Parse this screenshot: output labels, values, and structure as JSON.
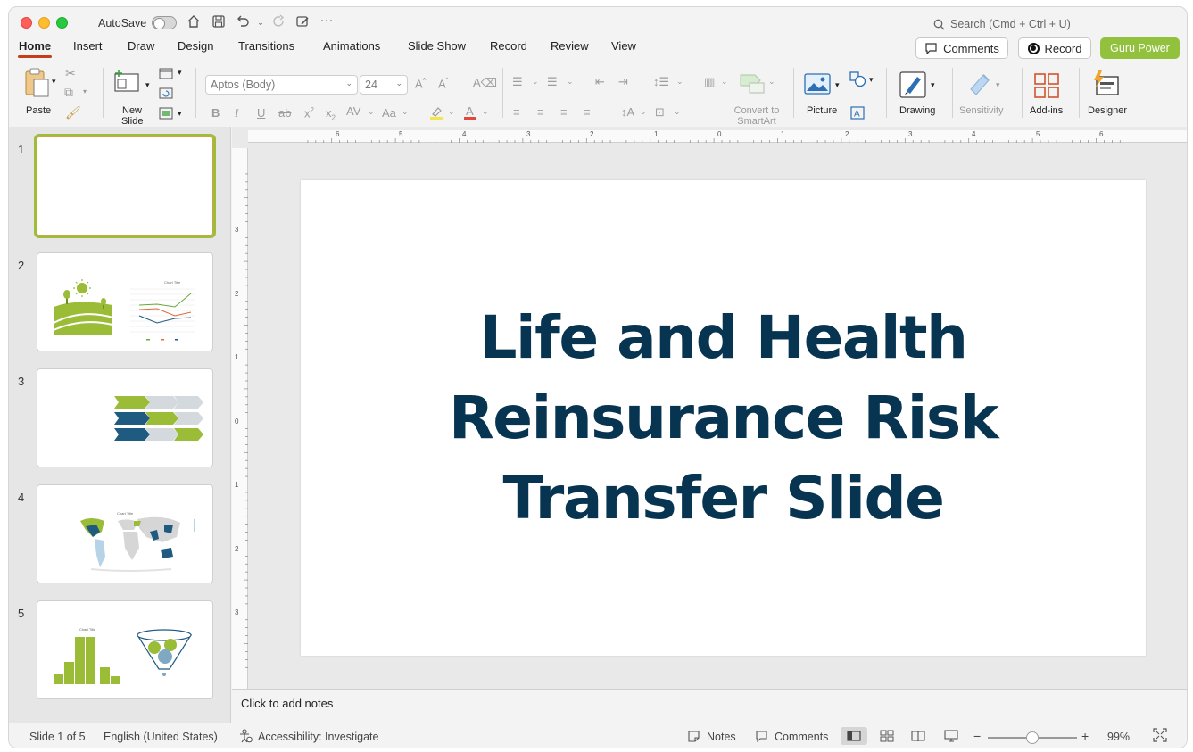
{
  "window": {
    "autosave_label": "AutoSave",
    "search_placeholder": "Search (Cmd + Ctrl + U)"
  },
  "tabs": [
    "Home",
    "Insert",
    "Draw",
    "Design",
    "Transitions",
    "Animations",
    "Slide Show",
    "Record",
    "Review",
    "View"
  ],
  "header_buttons": {
    "comments": "Comments",
    "record": "Record",
    "guru": "Guru Power"
  },
  "ribbon": {
    "paste": "Paste",
    "new_slide_1": "New",
    "new_slide_2": "Slide",
    "font_name": "Aptos (Body)",
    "font_size": "24",
    "convert_smartart_1": "Convert to",
    "convert_smartart_2": "SmartArt",
    "picture": "Picture",
    "drawing": "Drawing",
    "sensitivity": "Sensitivity",
    "addins": "Add-ins",
    "designer": "Designer"
  },
  "ruler": {
    "h_ticks": [
      "6",
      "5",
      "4",
      "3",
      "2",
      "1",
      "0",
      "1",
      "2",
      "3",
      "4",
      "5",
      "6"
    ],
    "v_ticks": [
      "3",
      "2",
      "1",
      "0",
      "1",
      "2",
      "3"
    ]
  },
  "thumbnails": [
    {
      "num": "1"
    },
    {
      "num": "2",
      "chart_title": "Chart Title"
    },
    {
      "num": "3"
    },
    {
      "num": "4",
      "chart_title": "Chart Title"
    },
    {
      "num": "5",
      "chart_title": "Chart Title"
    }
  ],
  "slide": {
    "title": "Life and Health Reinsurance Risk Transfer Slide"
  },
  "notes": {
    "placeholder": "Click to add notes"
  },
  "status": {
    "slide_count": "Slide 1 of 5",
    "language": "English (United States)",
    "accessibility": "Accessibility: Investigate",
    "notes": "Notes",
    "comments": "Comments",
    "zoom": "99%",
    "zoom_fraction": 0.5
  },
  "colors": {
    "accent_green": "#92c13e",
    "title_navy": "#073451",
    "tab_underline": "#c43e1c",
    "thumb_blue": "#1f5a80"
  }
}
